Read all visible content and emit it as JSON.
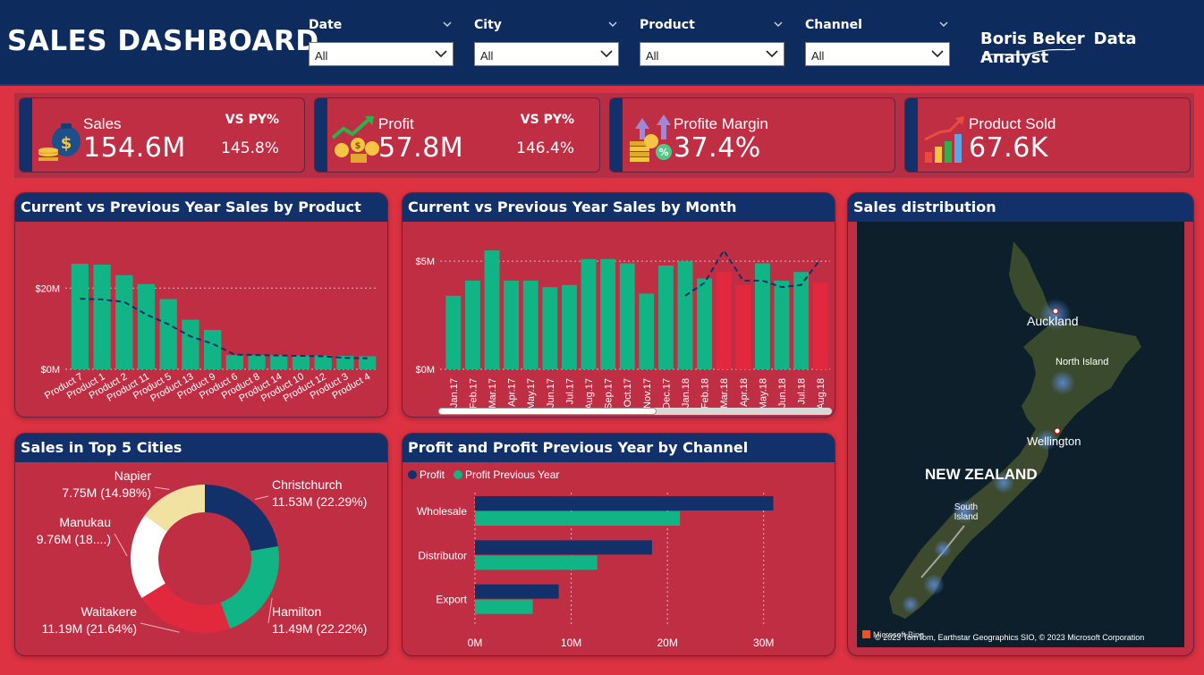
{
  "header": {
    "title": "SALES DASHBOARD",
    "brand_name": "Boris Beker",
    "brand_role": "Data Analyst"
  },
  "filters": [
    {
      "label": "Date",
      "value": "All"
    },
    {
      "label": "City",
      "value": "All"
    },
    {
      "label": "Product",
      "value": "All"
    },
    {
      "label": "Channel",
      "value": "All"
    }
  ],
  "kpis": [
    {
      "label": "Sales",
      "value": "154.6M",
      "py_label": "VS PY%",
      "py_value": "145.8%",
      "icon": "money-bag-icon"
    },
    {
      "label": "Profit",
      "value": "57.8M",
      "py_label": "VS PY%",
      "py_value": "146.4%",
      "icon": "profit-coins-icon"
    },
    {
      "label": "Profite Margin",
      "value": "37.4%",
      "icon": "margin-coins-icon"
    },
    {
      "label": "Product Sold",
      "value": "67.6K",
      "icon": "bar-growth-icon"
    }
  ],
  "panels": {
    "by_product": "Current vs Previous Year Sales by Product",
    "by_month": "Current vs Previous Year Sales by Month",
    "distribution": "Sales distribution",
    "top_cities": "Sales in Top 5 Cities",
    "by_channel": "Profit and Profit Previous Year by Channel"
  },
  "map": {
    "country": "NEW ZEALAND",
    "labels": [
      "Auckland",
      "North Island",
      "Wellington",
      "South Island"
    ],
    "attribution": "© 2023 TomTom, Earthstar Geographics SIO, © 2023 Microsoft Corporation",
    "provider": "Microsoft Bing"
  },
  "colors": {
    "current": "#11b585",
    "highlight": "#e1283c",
    "navy": "#12306a",
    "background": "#dc3241"
  },
  "chart_data": [
    {
      "type": "bar",
      "title": "Current vs Previous Year Sales by Product",
      "categories": [
        "Product 7",
        "Product 1",
        "Product 2",
        "Product 11",
        "Product 5",
        "Product 13",
        "Product 9",
        "Product 6",
        "Product 8",
        "Product 14",
        "Product 10",
        "Product 12",
        "Product 3",
        "Product 4"
      ],
      "series": [
        {
          "name": "Current Year",
          "values": [
            26,
            25.8,
            23.2,
            21,
            17.3,
            12.2,
            9.7,
            3.5,
            3.5,
            3.5,
            3.4,
            3.4,
            3.3,
            3.2
          ]
        },
        {
          "name": "Previous Year",
          "type": "line",
          "values": [
            17.4,
            17.2,
            16.6,
            13.5,
            11.1,
            8.1,
            6.3,
            3.6,
            3.5,
            3.4,
            3.3,
            3.2,
            2.8,
            2.7
          ]
        }
      ],
      "yticks": [
        "$0M",
        "$20M"
      ],
      "ylim": [
        0,
        28
      ]
    },
    {
      "type": "bar",
      "title": "Current vs Previous Year Sales by Month",
      "categories": [
        "Jan.17",
        "Feb.17",
        "Mar.17",
        "Apr.17",
        "May.17",
        "Jun.17",
        "Jul.17",
        "Aug.17",
        "Sep.17",
        "Oct.17",
        "Nov.17",
        "Dec.17",
        "Jan.18",
        "Feb.18",
        "Mar.18",
        "Apr.18",
        "May.18",
        "Jun.18",
        "Jul.18",
        "Aug.18"
      ],
      "series": [
        {
          "name": "Current Year",
          "values": [
            3.4,
            4.1,
            5.5,
            4.1,
            4.1,
            3.8,
            3.9,
            5.1,
            5.1,
            4.9,
            3.5,
            4.8,
            5.0,
            4.2,
            4.5,
            3.9,
            4.9,
            4.1,
            4.5,
            4.0
          ],
          "highlight": [
            false,
            false,
            false,
            false,
            false,
            false,
            false,
            false,
            false,
            false,
            false,
            false,
            false,
            false,
            true,
            true,
            false,
            false,
            false,
            true
          ]
        },
        {
          "name": "Previous Year",
          "type": "line",
          "values": [
            null,
            null,
            null,
            null,
            null,
            null,
            null,
            null,
            null,
            null,
            null,
            null,
            3.4,
            4.0,
            5.5,
            4.1,
            4.1,
            3.8,
            3.9,
            5.1
          ]
        }
      ],
      "yticks": [
        "$0M",
        "$5M"
      ],
      "ylim": [
        0,
        6
      ]
    },
    {
      "type": "pie",
      "title": "Sales in Top 5 Cities",
      "labels": [
        "Christchurch",
        "Hamilton",
        "Waitakere",
        "Manukau",
        "Napier"
      ],
      "values": [
        11.53,
        11.49,
        11.19,
        9.76,
        7.75
      ],
      "value_labels": [
        "11.53M (22.29%)",
        "11.49M (22.22%)",
        "11.19M (21.64%)",
        "9.76M (18....)",
        "7.75M (14.98%)"
      ],
      "colors": [
        "#12306a",
        "#11b585",
        "#e1283c",
        "#ffffff",
        "#f2e2a2"
      ]
    },
    {
      "type": "bar",
      "orientation": "horizontal",
      "title": "Profit and Profit Previous Year by Channel",
      "categories": [
        "Wholesale",
        "Distributor",
        "Export"
      ],
      "series": [
        {
          "name": "Profit",
          "values": [
            31,
            18.4,
            8.7
          ]
        },
        {
          "name": "Profit Previous Year",
          "values": [
            21.3,
            12.7,
            6
          ]
        }
      ],
      "xticks": [
        "0M",
        "10M",
        "20M",
        "30M"
      ],
      "xlim": [
        0,
        33
      ]
    }
  ]
}
